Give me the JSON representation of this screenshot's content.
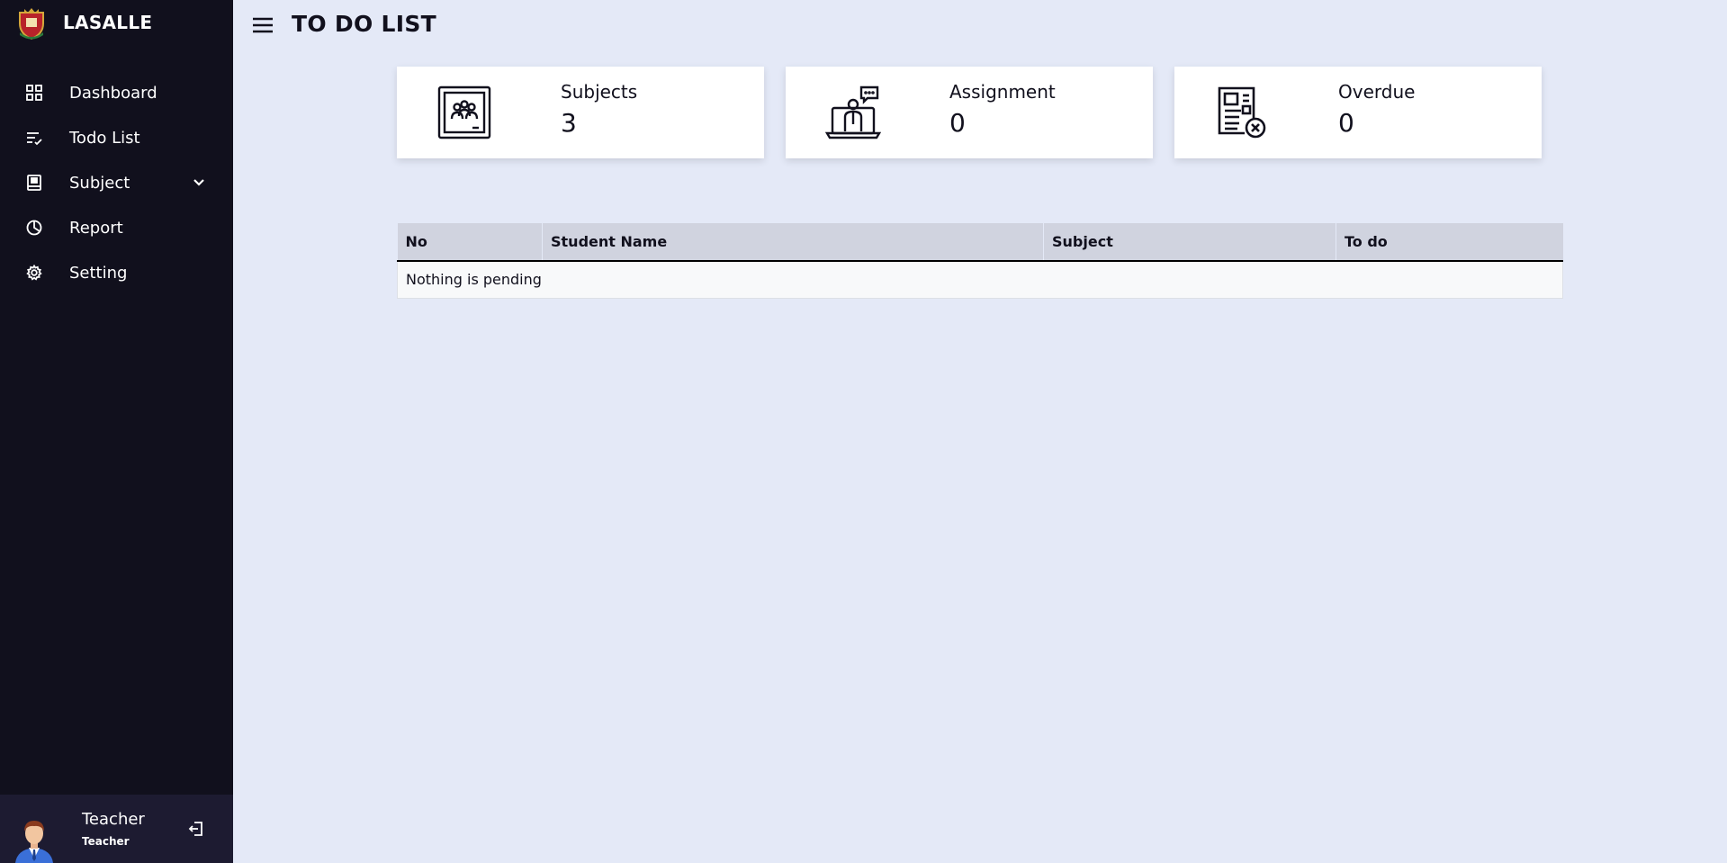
{
  "brand": {
    "name": "LASALLE",
    "logo": "lasalle-crest-logo"
  },
  "sidebar": {
    "items": [
      {
        "label": "Dashboard",
        "icon": "grid-icon"
      },
      {
        "label": "Todo List",
        "icon": "list-check-icon"
      },
      {
        "label": "Subject",
        "icon": "book-icon",
        "has_dropdown": true
      },
      {
        "label": "Report",
        "icon": "pie-chart-icon"
      },
      {
        "label": "Setting",
        "icon": "gear-icon"
      }
    ]
  },
  "profile": {
    "name": "Teacher",
    "role": "Teacher",
    "avatar": "teacher-avatar"
  },
  "header": {
    "title": "TO DO LIST"
  },
  "cards": [
    {
      "label": "Subjects",
      "value": "3",
      "icon": "classroom-board-icon"
    },
    {
      "label": "Assignment",
      "value": "0",
      "icon": "online-teacher-icon"
    },
    {
      "label": "Overdue",
      "value": "0",
      "icon": "document-overdue-icon"
    }
  ],
  "table": {
    "columns": [
      "No",
      "Student Name",
      "Subject",
      "To do"
    ],
    "empty_message": "Nothing is pending"
  },
  "colors": {
    "sidebar_bg": "#11101d",
    "profile_bg": "#1d1b31",
    "page_bg": "#e4e9f7",
    "card_bg": "#ffffff",
    "table_header_bg": "#d0d3df"
  }
}
